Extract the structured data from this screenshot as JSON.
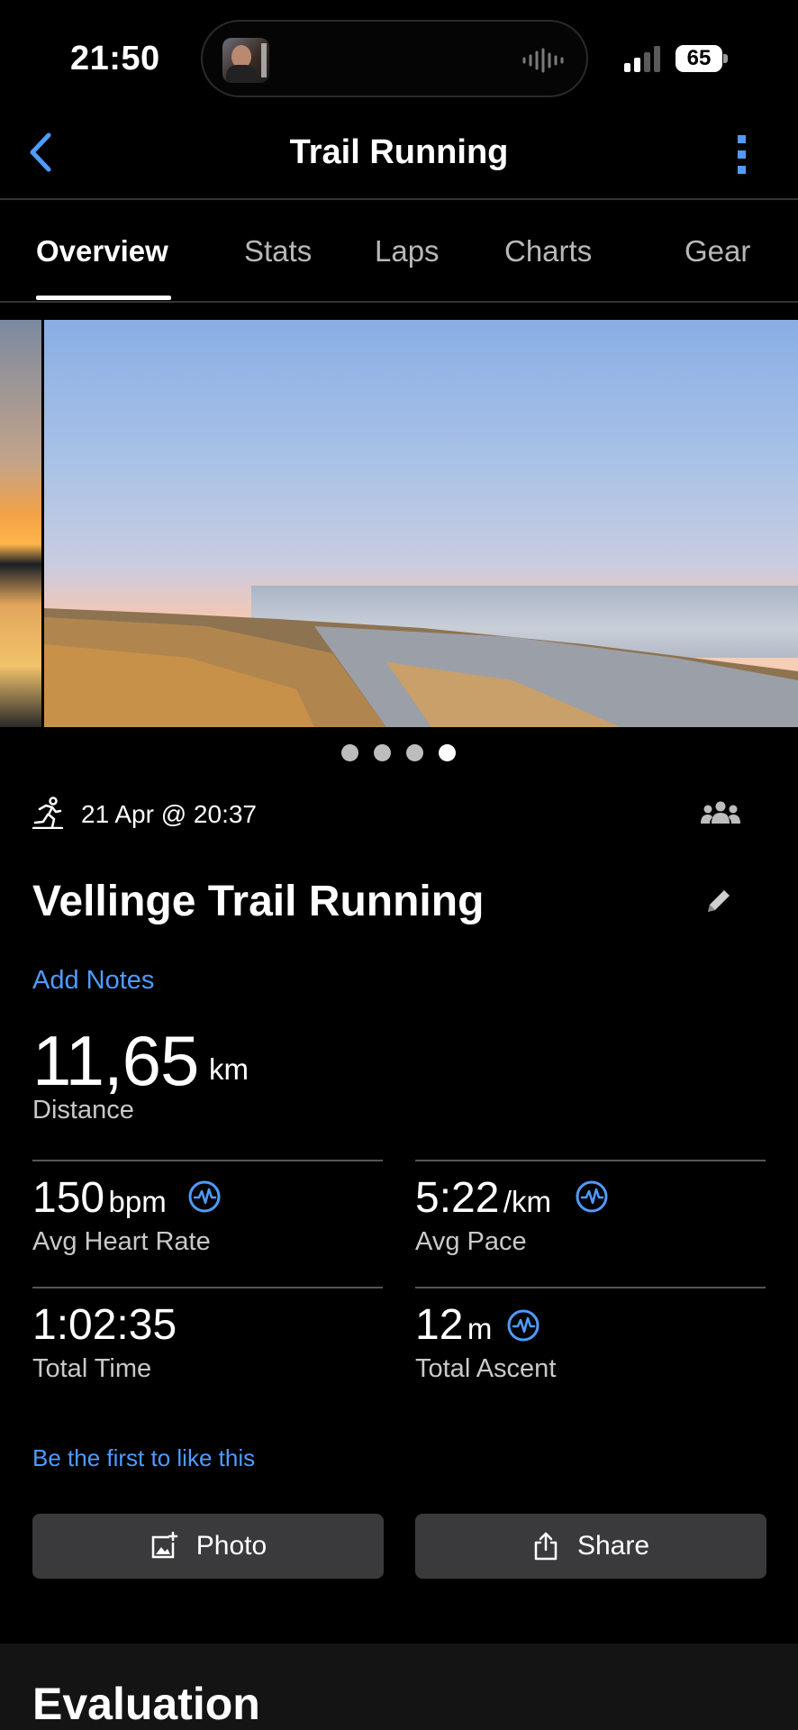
{
  "status_bar": {
    "time": "21:50",
    "battery": "65",
    "now_playing_icon": "podcast-artwork-thumbnail",
    "audio_icon": "waveform-icon"
  },
  "nav": {
    "title": "Trail Running",
    "back_icon": "chevron-left-icon",
    "more_icon": "more-vertical-icon"
  },
  "tabs": [
    {
      "label": "Overview",
      "active": true
    },
    {
      "label": "Stats",
      "active": false
    },
    {
      "label": "Laps",
      "active": false
    },
    {
      "label": "Charts",
      "active": false
    },
    {
      "label": "Gear",
      "active": false
    }
  ],
  "photos": {
    "count": 4,
    "active_index": 3
  },
  "activity": {
    "date": "21 Apr @ 20:37",
    "title": "Vellinge Trail Running",
    "add_notes": "Add Notes",
    "activity_icon": "running-icon",
    "privacy_icon": "group-icon",
    "edit_icon": "pencil-icon"
  },
  "distance": {
    "value": "11,65",
    "unit": "km",
    "label": "Distance"
  },
  "stats": [
    {
      "value": "150",
      "unit": "bpm",
      "label": "Avg Heart Rate",
      "has_icon": true
    },
    {
      "value": "5:22",
      "unit": "/km",
      "label": "Avg Pace",
      "has_icon": true
    },
    {
      "value": "1:02:35",
      "unit": "",
      "label": "Total Time",
      "has_icon": false
    },
    {
      "value": "12",
      "unit": "m",
      "label": "Total Ascent",
      "has_icon": true
    }
  ],
  "like_text": "Be the first to like this",
  "buttons": {
    "photo": "Photo",
    "share": "Share"
  },
  "evaluation": {
    "title": "Evaluation"
  },
  "colors": {
    "background": "#000000",
    "accent": "#4f9bff",
    "button_bg": "#3a3a3c",
    "divider": "#555555"
  }
}
